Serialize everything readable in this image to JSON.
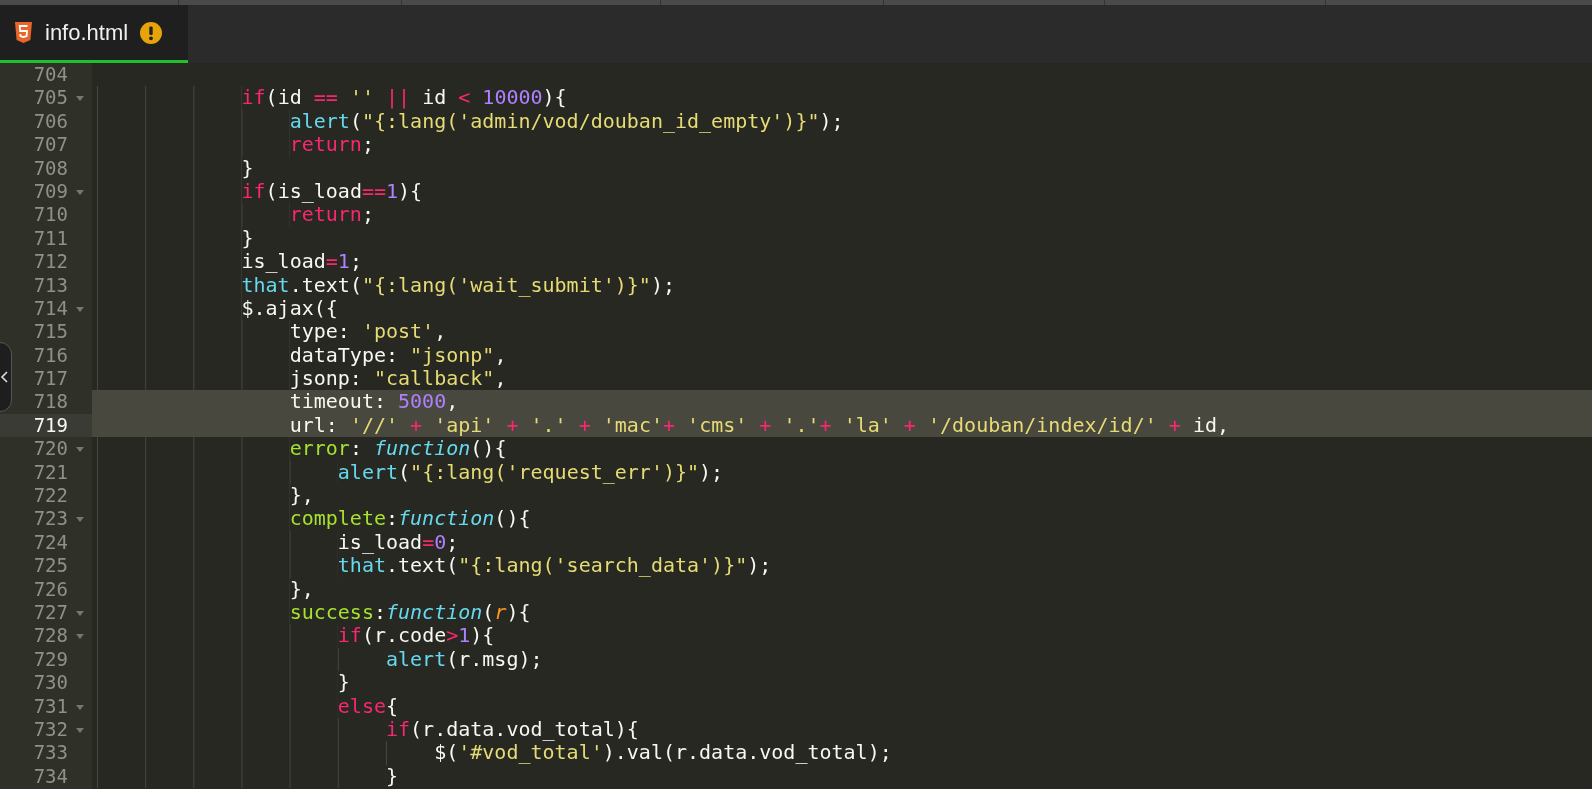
{
  "tab": {
    "title": "info.html",
    "warning": true
  },
  "lines": [
    {
      "number": "704",
      "foldable": false,
      "highlighted": false,
      "current": false
    },
    {
      "number": "705",
      "foldable": true,
      "highlighted": false,
      "current": false,
      "tokens": [
        {
          "kind": "keyword",
          "text": "            if"
        },
        {
          "kind": "plain",
          "text": "(id "
        },
        {
          "kind": "operator",
          "text": "=="
        },
        {
          "kind": "string",
          "text": " ''"
        },
        {
          "kind": "operator",
          "text": " ||"
        },
        {
          "kind": "plain",
          "text": " id "
        },
        {
          "kind": "operator",
          "text": "<"
        },
        {
          "kind": "number",
          "text": " 10000"
        },
        {
          "kind": "plain",
          "text": "){"
        }
      ]
    },
    {
      "number": "706",
      "foldable": false,
      "highlighted": false,
      "current": false,
      "tokens": [
        {
          "kind": "builtin",
          "text": "                alert"
        },
        {
          "kind": "plain",
          "text": "("
        },
        {
          "kind": "string",
          "text": "\"{:lang('admin/vod/douban_id_empty')}\""
        },
        {
          "kind": "plain",
          "text": ");"
        }
      ]
    },
    {
      "number": "707",
      "foldable": false,
      "highlighted": false,
      "current": false,
      "tokens": [
        {
          "kind": "keyword",
          "text": "                return"
        },
        {
          "kind": "plain",
          "text": ";"
        }
      ]
    },
    {
      "number": "708",
      "foldable": false,
      "highlighted": false,
      "current": false,
      "tokens": [
        {
          "kind": "plain",
          "text": "            }"
        }
      ]
    },
    {
      "number": "709",
      "foldable": true,
      "highlighted": false,
      "current": false,
      "tokens": [
        {
          "kind": "keyword",
          "text": "            if"
        },
        {
          "kind": "plain",
          "text": "(is_load"
        },
        {
          "kind": "operator",
          "text": "=="
        },
        {
          "kind": "number",
          "text": "1"
        },
        {
          "kind": "plain",
          "text": "){"
        }
      ]
    },
    {
      "number": "710",
      "foldable": false,
      "highlighted": false,
      "current": false,
      "tokens": [
        {
          "kind": "keyword",
          "text": "                return"
        },
        {
          "kind": "plain",
          "text": ";"
        }
      ]
    },
    {
      "number": "711",
      "foldable": false,
      "highlighted": false,
      "current": false,
      "tokens": [
        {
          "kind": "plain",
          "text": "            }"
        }
      ]
    },
    {
      "number": "712",
      "foldable": false,
      "highlighted": false,
      "current": false,
      "tokens": [
        {
          "kind": "plain",
          "text": "            is_load"
        },
        {
          "kind": "operator",
          "text": "="
        },
        {
          "kind": "number",
          "text": "1"
        },
        {
          "kind": "plain",
          "text": ";"
        }
      ]
    },
    {
      "number": "713",
      "foldable": false,
      "highlighted": false,
      "current": false,
      "tokens": [
        {
          "kind": "builtin",
          "text": "            that"
        },
        {
          "kind": "plain",
          "text": ".text("
        },
        {
          "kind": "string",
          "text": "\"{:lang('wait_submit')}\""
        },
        {
          "kind": "plain",
          "text": ");"
        }
      ]
    },
    {
      "number": "714",
      "foldable": true,
      "highlighted": false,
      "current": false,
      "tokens": [
        {
          "kind": "plain",
          "text": "            $.ajax({"
        }
      ]
    },
    {
      "number": "715",
      "foldable": false,
      "highlighted": false,
      "current": false,
      "tokens": [
        {
          "kind": "plain",
          "text": "                type: "
        },
        {
          "kind": "string",
          "text": "'post'"
        },
        {
          "kind": "plain",
          "text": ","
        }
      ]
    },
    {
      "number": "716",
      "foldable": false,
      "highlighted": false,
      "current": false,
      "tokens": [
        {
          "kind": "plain",
          "text": "                dataType: "
        },
        {
          "kind": "string",
          "text": "\"jsonp\""
        },
        {
          "kind": "plain",
          "text": ","
        }
      ]
    },
    {
      "number": "717",
      "foldable": false,
      "highlighted": false,
      "current": false,
      "tokens": [
        {
          "kind": "plain",
          "text": "                jsonp: "
        },
        {
          "kind": "string",
          "text": "\"callback\""
        },
        {
          "kind": "plain",
          "text": ","
        }
      ]
    },
    {
      "number": "718",
      "foldable": false,
      "highlighted": true,
      "current": false,
      "tokens": [
        {
          "kind": "plain",
          "text": "                timeout: "
        },
        {
          "kind": "number",
          "text": "5000"
        },
        {
          "kind": "plain",
          "text": ","
        }
      ]
    },
    {
      "number": "719",
      "foldable": false,
      "highlighted": true,
      "current": true,
      "tokens": [
        {
          "kind": "plain",
          "text": "                url: "
        },
        {
          "kind": "string",
          "text": "'//'"
        },
        {
          "kind": "operator",
          "text": " +"
        },
        {
          "kind": "string",
          "text": " 'api'"
        },
        {
          "kind": "operator",
          "text": " +"
        },
        {
          "kind": "string",
          "text": " '.'"
        },
        {
          "kind": "operator",
          "text": " +"
        },
        {
          "kind": "string",
          "text": " 'mac'"
        },
        {
          "kind": "operator",
          "text": "+"
        },
        {
          "kind": "string",
          "text": " 'cms'"
        },
        {
          "kind": "operator",
          "text": " +"
        },
        {
          "kind": "string",
          "text": " '.'"
        },
        {
          "kind": "operator",
          "text": "+"
        },
        {
          "kind": "string",
          "text": " 'la'"
        },
        {
          "kind": "operator",
          "text": " +"
        },
        {
          "kind": "string",
          "text": " '/douban/index/id/'"
        },
        {
          "kind": "operator",
          "text": " +"
        },
        {
          "kind": "plain",
          "text": " id,"
        }
      ]
    },
    {
      "number": "720",
      "foldable": true,
      "highlighted": false,
      "current": false,
      "tokens": [
        {
          "kind": "property",
          "text": "                error"
        },
        {
          "kind": "plain",
          "text": ": "
        },
        {
          "kind": "function",
          "text": "function"
        },
        {
          "kind": "plain",
          "text": "(){"
        }
      ]
    },
    {
      "number": "721",
      "foldable": false,
      "highlighted": false,
      "current": false,
      "tokens": [
        {
          "kind": "builtin",
          "text": "                    alert"
        },
        {
          "kind": "plain",
          "text": "("
        },
        {
          "kind": "string",
          "text": "\"{:lang('request_err')}\""
        },
        {
          "kind": "plain",
          "text": ");"
        }
      ]
    },
    {
      "number": "722",
      "foldable": false,
      "highlighted": false,
      "current": false,
      "tokens": [
        {
          "kind": "plain",
          "text": "                },"
        }
      ]
    },
    {
      "number": "723",
      "foldable": true,
      "highlighted": false,
      "current": false,
      "tokens": [
        {
          "kind": "property",
          "text": "                complete"
        },
        {
          "kind": "plain",
          "text": ":"
        },
        {
          "kind": "function",
          "text": "function"
        },
        {
          "kind": "plain",
          "text": "(){"
        }
      ]
    },
    {
      "number": "724",
      "foldable": false,
      "highlighted": false,
      "current": false,
      "tokens": [
        {
          "kind": "plain",
          "text": "                    is_load"
        },
        {
          "kind": "operator",
          "text": "="
        },
        {
          "kind": "number",
          "text": "0"
        },
        {
          "kind": "plain",
          "text": ";"
        }
      ]
    },
    {
      "number": "725",
      "foldable": false,
      "highlighted": false,
      "current": false,
      "tokens": [
        {
          "kind": "builtin",
          "text": "                    that"
        },
        {
          "kind": "plain",
          "text": ".text("
        },
        {
          "kind": "string",
          "text": "\"{:lang('search_data')}\""
        },
        {
          "kind": "plain",
          "text": ");"
        }
      ]
    },
    {
      "number": "726",
      "foldable": false,
      "highlighted": false,
      "current": false,
      "tokens": [
        {
          "kind": "plain",
          "text": "                },"
        }
      ]
    },
    {
      "number": "727",
      "foldable": true,
      "highlighted": false,
      "current": false,
      "tokens": [
        {
          "kind": "property",
          "text": "                success"
        },
        {
          "kind": "plain",
          "text": ":"
        },
        {
          "kind": "function",
          "text": "function"
        },
        {
          "kind": "plain",
          "text": "("
        },
        {
          "kind": "param",
          "text": "r"
        },
        {
          "kind": "plain",
          "text": "){"
        }
      ]
    },
    {
      "number": "728",
      "foldable": true,
      "highlighted": false,
      "current": false,
      "tokens": [
        {
          "kind": "keyword",
          "text": "                    if"
        },
        {
          "kind": "plain",
          "text": "(r.code"
        },
        {
          "kind": "operator",
          "text": ">"
        },
        {
          "kind": "number",
          "text": "1"
        },
        {
          "kind": "plain",
          "text": "){"
        }
      ]
    },
    {
      "number": "729",
      "foldable": false,
      "highlighted": false,
      "current": false,
      "tokens": [
        {
          "kind": "builtin",
          "text": "                        alert"
        },
        {
          "kind": "plain",
          "text": "(r.msg);"
        }
      ]
    },
    {
      "number": "730",
      "foldable": false,
      "highlighted": false,
      "current": false,
      "tokens": [
        {
          "kind": "plain",
          "text": "                    }"
        }
      ]
    },
    {
      "number": "731",
      "foldable": true,
      "highlighted": false,
      "current": false,
      "tokens": [
        {
          "kind": "keyword",
          "text": "                    else"
        },
        {
          "kind": "plain",
          "text": "{"
        }
      ]
    },
    {
      "number": "732",
      "foldable": true,
      "highlighted": false,
      "current": false,
      "tokens": [
        {
          "kind": "keyword",
          "text": "                        if"
        },
        {
          "kind": "plain",
          "text": "(r.data.vod_total){"
        }
      ]
    },
    {
      "number": "733",
      "foldable": false,
      "highlighted": false,
      "current": false,
      "tokens": [
        {
          "kind": "plain",
          "text": "                            $("
        },
        {
          "kind": "string",
          "text": "'#vod_total'"
        },
        {
          "kind": "plain",
          "text": ").val(r.data.vod_total);"
        }
      ]
    },
    {
      "number": "734",
      "foldable": false,
      "highlighted": false,
      "current": false,
      "tokens": [
        {
          "kind": "plain",
          "text": "                        }"
        }
      ]
    }
  ]
}
